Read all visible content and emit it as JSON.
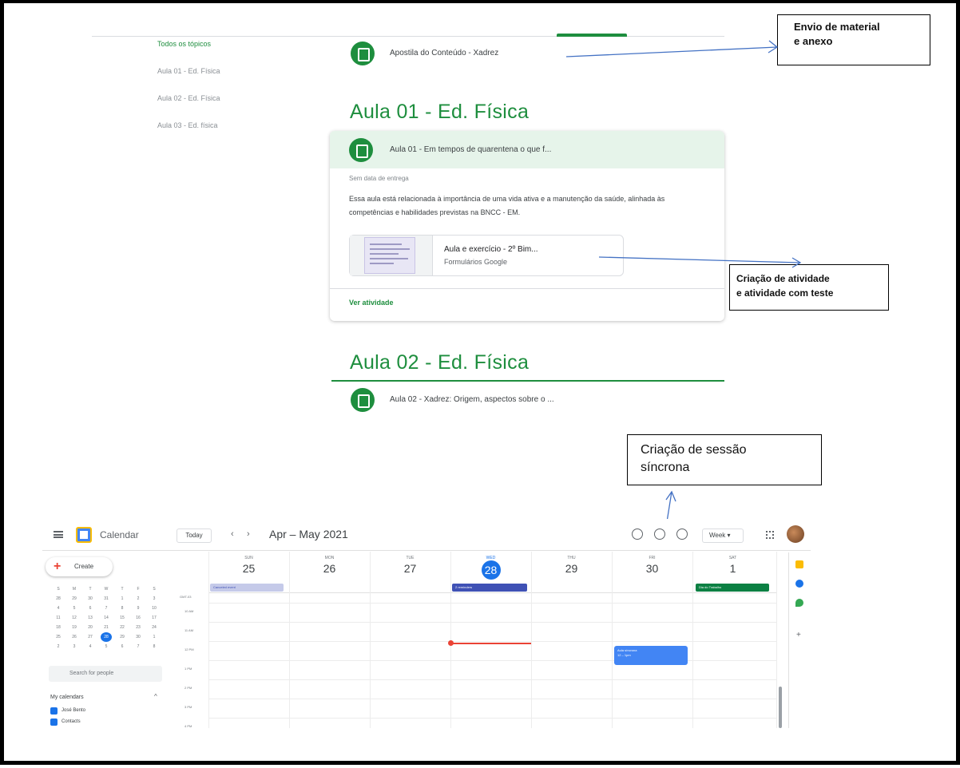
{
  "classroom": {
    "sidebar": [
      "Todos os tópicos",
      "Aula 01 - Ed. Física",
      "Aula 02 - Ed. Física",
      "Aula 03 - Ed. física"
    ],
    "material_title": "Apostila do Conteúdo - Xadrez",
    "topic1": "Aula 01 - Ed. Física",
    "assignment_title": "Aula 01 - Em tempos de quarentena o que f...",
    "due": "Sem data de entrega",
    "description": "Essa aula está relacionada à importância de uma vida ativa e a manutenção da saúde, alinhada às competências e habilidades previstas na BNCC - EM.",
    "attachment_title": "Aula e exercício - 2º Bim...",
    "attachment_type": "Formulários Google",
    "view_link": "Ver atividade",
    "topic2": "Aula 02 - Ed. Física",
    "material2_title": "Aula 02 - Xadrez: Origem, aspectos sobre o ..."
  },
  "callouts": {
    "envio_l1": "Envio de material",
    "envio_l2": "e anexo",
    "criacao_l1": "Criação de atividade",
    "criacao_l2": "e atividade com teste",
    "sessao_l1": "Criação de sessão",
    "sessao_l2": "síncrona"
  },
  "calendar": {
    "app_name": "Calendar",
    "today": "Today",
    "prev": "‹",
    "next": "›",
    "month": "Apr – May 2021",
    "view": "Week ▾",
    "create": "Create",
    "search_people": "Search for people",
    "my_calendars": "My calendars",
    "cal_items": [
      "José Bento",
      "Contacts"
    ],
    "timezone": "GMT-03",
    "days": [
      {
        "name": "SUN",
        "num": "25"
      },
      {
        "name": "MON",
        "num": "26"
      },
      {
        "name": "TUE",
        "num": "27"
      },
      {
        "name": "WED",
        "num": "28"
      },
      {
        "name": "THU",
        "num": "29"
      },
      {
        "name": "FRI",
        "num": "30"
      },
      {
        "name": "SAT",
        "num": "1"
      }
    ],
    "hours": [
      "10 AM",
      "11 AM",
      "12 PM",
      "1 PM",
      "2 PM",
      "3 PM",
      "4 PM"
    ],
    "events": {
      "sun": "Canceled event",
      "wed": "2 reminders",
      "sat": "Dia do Trabalho",
      "sync_title": "Aula síncrona",
      "sync_time": "12 – 1pm"
    },
    "colors": {
      "blue": "#4285f4",
      "indigo": "#3f51b5",
      "teal": "#0b8043",
      "red": "#ea4335",
      "green": "#1e8e3e"
    }
  }
}
